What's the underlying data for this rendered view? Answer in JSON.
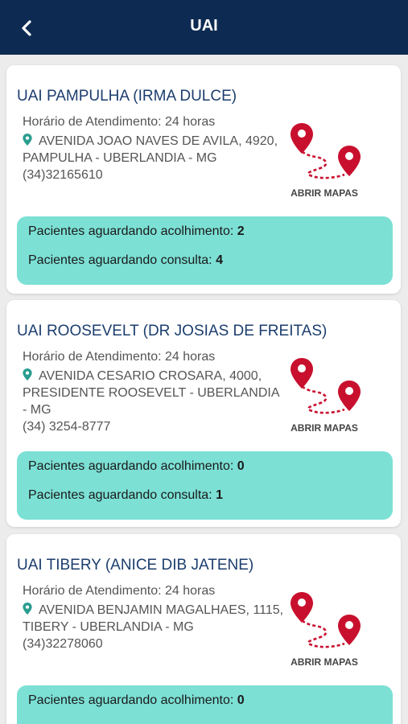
{
  "header": {
    "title": "UAI",
    "back_icon": "chevron-left-icon"
  },
  "colors": {
    "header_bg": "#0d2b52",
    "title_text": "#1c3e6e",
    "wait_box_bg": "#7ce0d5",
    "pin_red": "#c8102e",
    "address_pin": "#2a9d8f"
  },
  "cards": [
    {
      "title": "UAI PAMPULHA (IRMA DULCE)",
      "hours": "Horário de Atendimento: 24 horas",
      "address": "AVENIDA JOAO NAVES DE AVILA, 4920, PAMPULHA - UBERLANDIA - MG",
      "phone": "(34)32165610",
      "map_label": "ABRIR MAPAS",
      "wait_reception_label": "Pacientes aguardando acolhimento:",
      "wait_reception_value": "2",
      "wait_consult_label": "Pacientes aguardando consulta:",
      "wait_consult_value": "4"
    },
    {
      "title": "UAI ROOSEVELT (DR JOSIAS DE FREITAS)",
      "hours": "Horário de Atendimento: 24 horas",
      "address": "AVENIDA CESARIO CROSARA, 4000, PRESIDENTE ROOSEVELT - UBERLANDIA - MG",
      "phone": "(34) 3254-8777",
      "map_label": "ABRIR MAPAS",
      "wait_reception_label": "Pacientes aguardando acolhimento:",
      "wait_reception_value": "0",
      "wait_consult_label": "Pacientes aguardando consulta:",
      "wait_consult_value": "1"
    },
    {
      "title": "UAI TIBERY (ANICE DIB JATENE)",
      "hours": "Horário de Atendimento: 24 horas",
      "address": "AVENIDA BENJAMIN MAGALHAES, 1115, TIBERY - UBERLANDIA - MG",
      "phone": "(34)32278060",
      "map_label": "ABRIR MAPAS",
      "wait_reception_label": "Pacientes aguardando acolhimento:",
      "wait_reception_value": "0"
    }
  ]
}
